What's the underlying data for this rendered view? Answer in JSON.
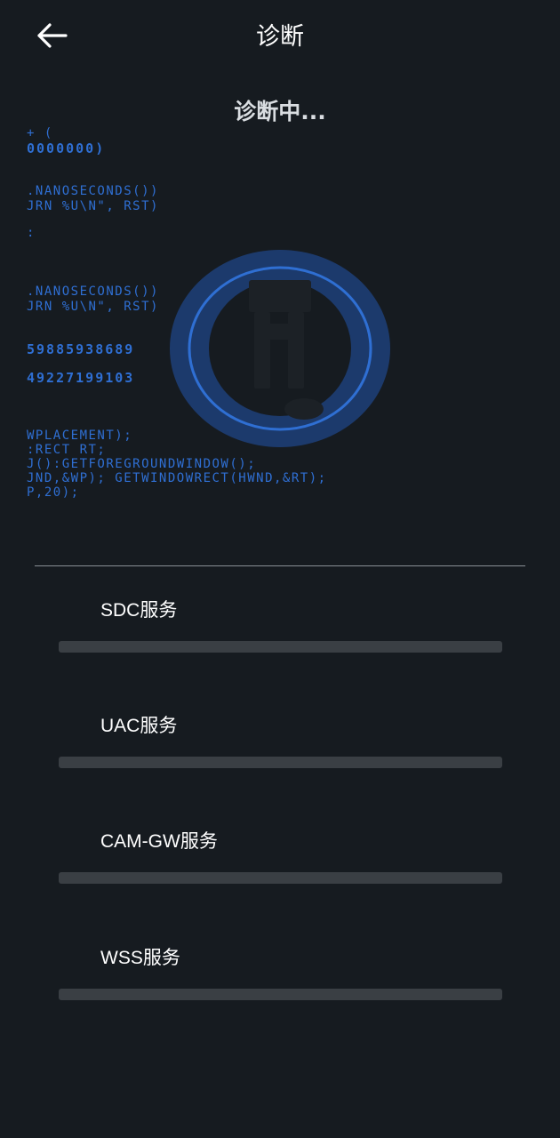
{
  "header": {
    "title": "诊断",
    "back_icon": "arrow-left-icon"
  },
  "status": {
    "text": "诊断中..."
  },
  "code_rain": {
    "color": "#2f6fd3",
    "lines": [
      "+ (",
      "0000000)",
      ".NANOSECONDS())",
      "JRN %U\\N\", RST)",
      ":",
      ".NANOSECONDS())",
      "JRN %U\\N\", RST)",
      "59885938689",
      "49227199103",
      "WPLACEMENT);",
      ":RECT RT;",
      "J():GETFOREGROUNDWINDOW();",
      "JND,&WP); GETWINDOWRECT(HWND,&RT);",
      "P,20);"
    ]
  },
  "scanner": {
    "icon": "scanning-ring-icon",
    "ring_color": "#2a5fb8",
    "outer_color": "#1d3f7a"
  },
  "services": [
    {
      "label": "SDC服务",
      "progress": 0
    },
    {
      "label": "UAC服务",
      "progress": 0
    },
    {
      "label": "CAM-GW服务",
      "progress": 0
    },
    {
      "label": "WSS服务",
      "progress": 0
    }
  ]
}
